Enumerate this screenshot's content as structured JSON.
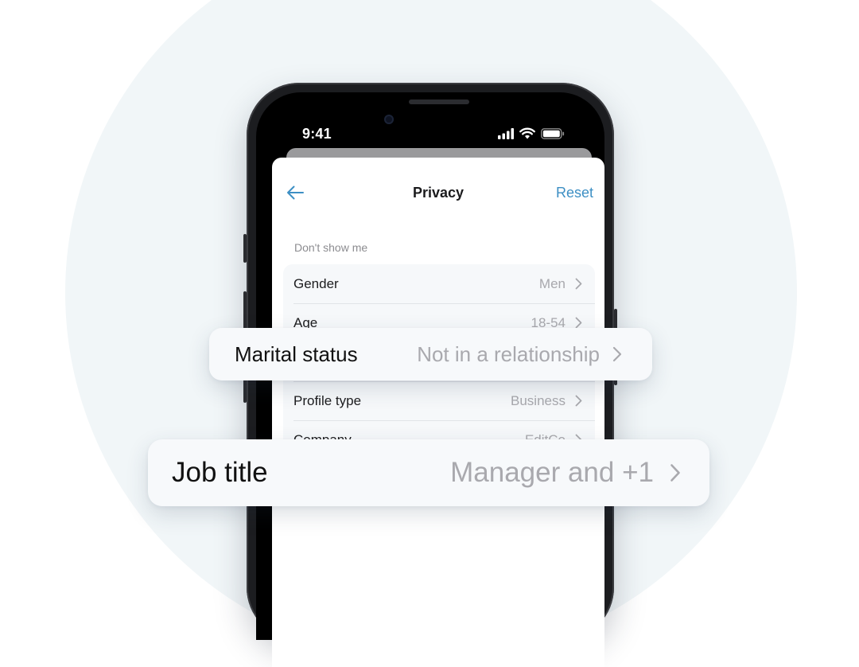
{
  "status_bar": {
    "time": "9:41"
  },
  "nav": {
    "title": "Privacy",
    "reset_label": "Reset"
  },
  "section": {
    "label": "Don't show me"
  },
  "rows": [
    {
      "label": "Gender",
      "value": "Men"
    },
    {
      "label": "Age",
      "value": "18-54"
    },
    {
      "label": "Profile type",
      "value": "Business"
    },
    {
      "label": "Company",
      "value": "EditCo"
    }
  ],
  "highlight_cards": {
    "marital": {
      "label": "Marital status",
      "value": "Not in a relationship"
    },
    "job": {
      "label": "Job title",
      "value": "Manager and +1"
    }
  },
  "icons": [
    "back-arrow-icon",
    "chevron-right-icon",
    "signal-icon",
    "wifi-icon",
    "battery-icon",
    "camera-icon"
  ],
  "colors": {
    "accent": "#3d8fc4",
    "background_circle": "#f1f6f8",
    "phone_body": "#1c1d20"
  }
}
